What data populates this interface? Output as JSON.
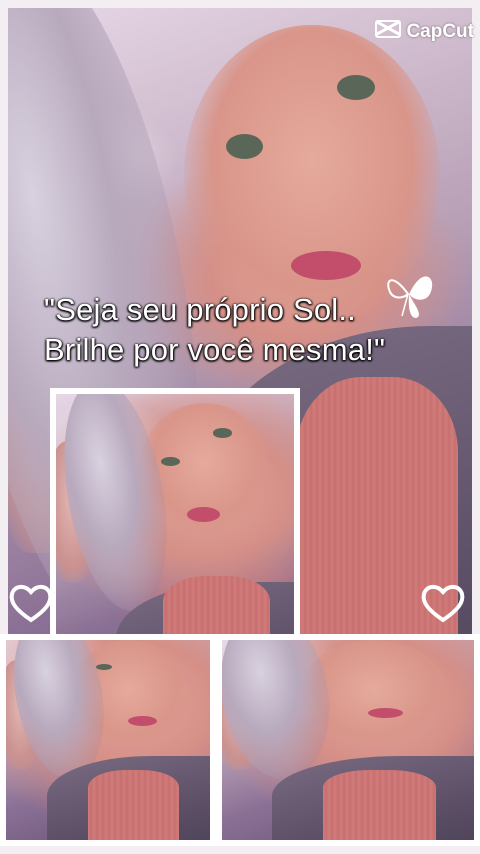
{
  "watermark": {
    "brand": "CapCut",
    "icon": "capcut-logo-icon"
  },
  "quote": {
    "line1": "\"Seja seu próprio Sol..",
    "line2": "Brilhe por você mesma!\""
  },
  "decorations": {
    "left_heart": "heart-outline-icon",
    "right_heart": "heart-outline-icon",
    "butterfly": "butterfly-icon"
  },
  "colors": {
    "frame_border": "#ffffff",
    "text": "#ffffff",
    "background": "#f3eef2"
  }
}
